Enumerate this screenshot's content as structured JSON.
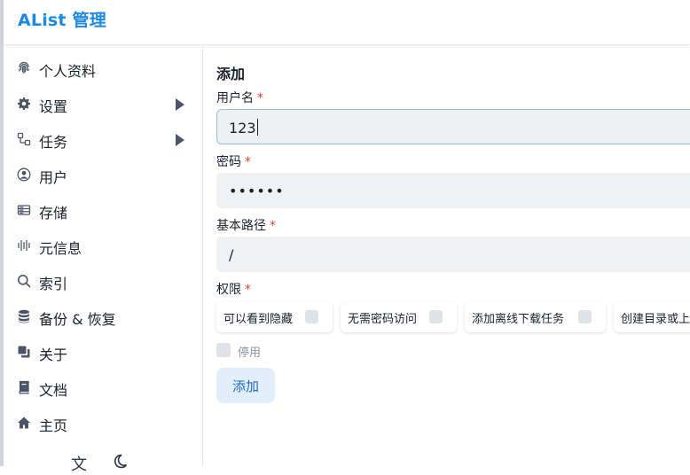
{
  "header": {
    "title": "AList 管理"
  },
  "sidebar": {
    "items": [
      {
        "label": "个人资料",
        "icon": "fingerprint-icon"
      },
      {
        "label": "设置",
        "icon": "gear-icon",
        "expandable": true
      },
      {
        "label": "任务",
        "icon": "workflow-icon",
        "expandable": true
      },
      {
        "label": "用户",
        "icon": "user-circle-icon"
      },
      {
        "label": "存储",
        "icon": "storage-icon"
      },
      {
        "label": "元信息",
        "icon": "metadata-icon"
      },
      {
        "label": "索引",
        "icon": "search-icon"
      },
      {
        "label": "备份 & 恢复",
        "icon": "database-icon"
      },
      {
        "label": "关于",
        "icon": "copy-icon"
      },
      {
        "label": "文档",
        "icon": "book-icon"
      },
      {
        "label": "主页",
        "icon": "home-icon"
      }
    ],
    "bottom": {
      "language_glyph": "文",
      "theme_icon": "moon-icon"
    }
  },
  "form": {
    "title": "添加",
    "required_mark": "*",
    "username": {
      "label": "用户名",
      "value": "123"
    },
    "password": {
      "label": "密码",
      "value": "••••••"
    },
    "base_path": {
      "label": "基本路径",
      "value": "/"
    },
    "permissions": {
      "label": "权限",
      "options": [
        {
          "label": "可以看到隐藏",
          "checked": false
        },
        {
          "label": "无需密码访问",
          "checked": false
        },
        {
          "label": "添加离线下载任务",
          "checked": false
        },
        {
          "label": "创建目录或上传",
          "checked": false
        }
      ]
    },
    "disabled": {
      "label": "停用",
      "checked": false
    },
    "submit_label": "添加"
  },
  "colors": {
    "brand": "#1e88e5",
    "required": "#e53e3e",
    "button_bg": "#e3eefb",
    "button_text": "#1a6fc2",
    "focus_border": "#90bde6"
  }
}
